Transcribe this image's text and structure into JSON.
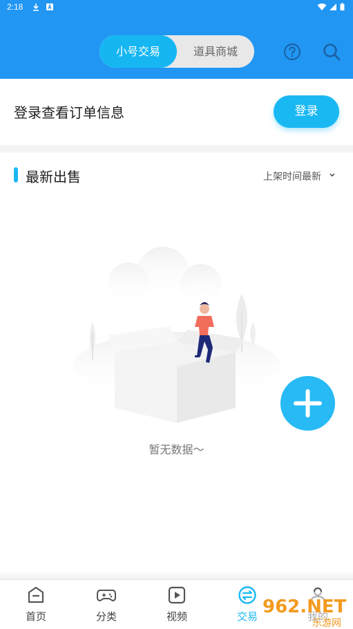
{
  "status_bar": {
    "time": "2:18"
  },
  "header": {
    "tabs": [
      {
        "label": "小号交易",
        "active": true
      },
      {
        "label": "道具商城",
        "active": false
      }
    ],
    "help_icon": "question-circle-icon",
    "search_icon": "search-icon"
  },
  "login": {
    "prompt": "登录查看订单信息",
    "button_label": "登录"
  },
  "section": {
    "title": "最新出售",
    "sort_label": "上架时间最新"
  },
  "empty_state": {
    "text": "暂无数据～"
  },
  "fab": {
    "icon": "plus-icon"
  },
  "bottom_nav": {
    "items": [
      {
        "label": "首页",
        "icon": "home-icon",
        "active": false
      },
      {
        "label": "分类",
        "icon": "gamepad-icon",
        "active": false
      },
      {
        "label": "视频",
        "icon": "play-icon",
        "active": false
      },
      {
        "label": "交易",
        "icon": "exchange-icon",
        "active": true
      },
      {
        "label": "我的",
        "icon": "user-icon",
        "active": false
      }
    ]
  },
  "watermark": {
    "text": "962.NET",
    "subtext": "乐游网"
  },
  "colors": {
    "header_bg": "#2196f3",
    "accent": "#1ab8f3",
    "fab": "#27baf4"
  }
}
